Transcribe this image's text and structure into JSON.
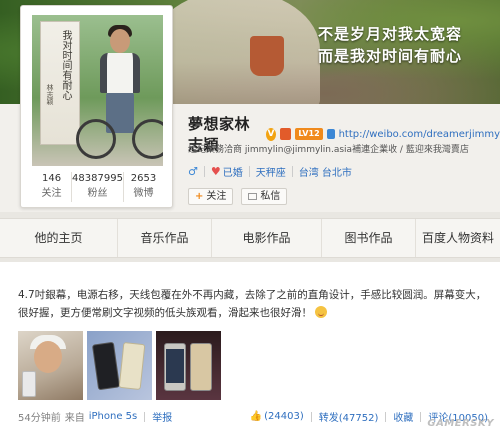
{
  "banner": {
    "slogan_line1": "不是岁月对我太宽容",
    "slogan_line2": "而是我对时间有耐心"
  },
  "profile": {
    "book_title": "我对时间有耐心",
    "book_author": "林志颖",
    "stats": [
      {
        "num": "146",
        "label": "关注"
      },
      {
        "num": "48387995",
        "label": "粉丝"
      },
      {
        "num": "2653",
        "label": "微博"
      }
    ],
    "name": "夢想家林志穎",
    "verified_mark": "V",
    "level": "LV12",
    "home_url": "http://weibo.com/dreamerjimmy",
    "bio": "经纪業務洽商 jimmylin@jimmylin.asia補連企業收 / 藍迎來我灣賣店",
    "gender_symbol": "♂",
    "marital": "已婚",
    "zodiac": "天秤座",
    "location": "台湾 台北市",
    "follow_label": "关注",
    "message_label": "私信"
  },
  "tabs": [
    "他的主页",
    "音乐作品",
    "电影作品",
    "图书作品",
    "百度人物资料"
  ],
  "post": {
    "text": "4.7吋銀幕，电源右移，天线包覆在外不再内藏，去除了之前的直角设计，手感比较圆润。屏幕变大，很好握，更方便常刷文字视频的低头族观看，滑起来也很好滑！",
    "time": "54分钟前",
    "source_prefix": "来自",
    "source": "iPhone 5s",
    "report": "举报",
    "likes": "(24403)",
    "reposts": "转发(47752)",
    "favorite": "收藏",
    "comments": "评论(10050)"
  },
  "watermark": "GAMERSKY",
  "colors": {
    "link": "#2f6fbf",
    "verified": "#f2a312",
    "level_badge": "#f08a1c"
  }
}
